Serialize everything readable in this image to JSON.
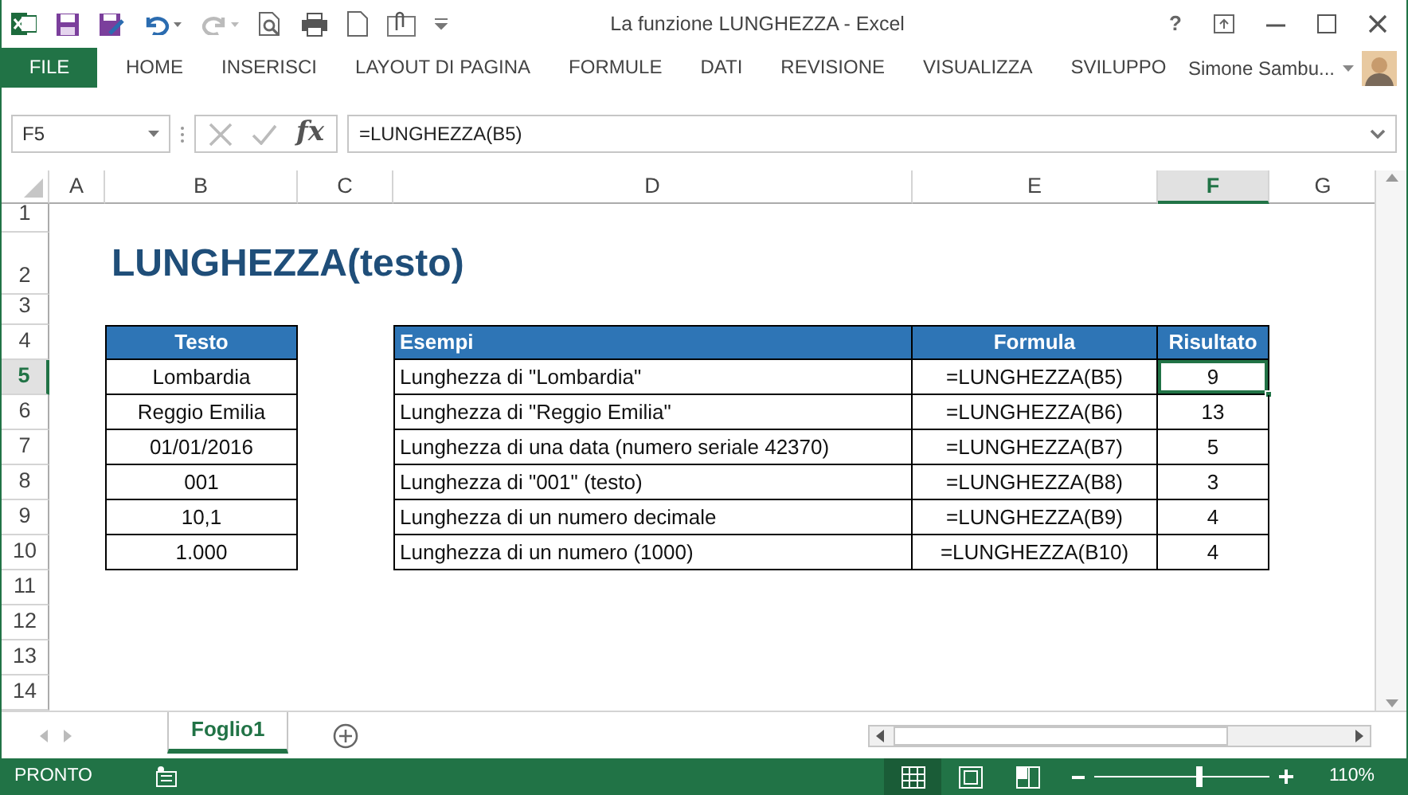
{
  "window": {
    "title": "La funzione LUNGHEZZA - Excel",
    "help": "?"
  },
  "ribbon": {
    "tabs": [
      {
        "label": "FILE",
        "kind": "file",
        "selected": false
      },
      {
        "label": "HOME",
        "kind": "tab",
        "selected": false
      },
      {
        "label": "INSERISCI",
        "kind": "tab",
        "selected": false
      },
      {
        "label": "LAYOUT DI PAGINA",
        "kind": "tab",
        "selected": false
      },
      {
        "label": "FORMULE",
        "kind": "tab",
        "selected": false
      },
      {
        "label": "DATI",
        "kind": "tab",
        "selected": false
      },
      {
        "label": "REVISIONE",
        "kind": "tab",
        "selected": false
      },
      {
        "label": "VISUALIZZA",
        "kind": "tab",
        "selected": false
      },
      {
        "label": "SVILUPPO",
        "kind": "tab",
        "selected": false
      }
    ],
    "user": "Simone Sambu..."
  },
  "formula_bar": {
    "name_box": "F5",
    "function_symbol": "fx",
    "formula": "=LUNGHEZZA(B5)"
  },
  "sheet": {
    "columns": [
      {
        "label": "A",
        "selected": false
      },
      {
        "label": "B",
        "selected": false
      },
      {
        "label": "C",
        "selected": false
      },
      {
        "label": "D",
        "selected": false
      },
      {
        "label": "E",
        "selected": false
      },
      {
        "label": "F",
        "selected": true
      },
      {
        "label": "G",
        "selected": false
      }
    ],
    "rows": [
      {
        "label": "1",
        "selected": false
      },
      {
        "label": "2",
        "selected": false
      },
      {
        "label": "3",
        "selected": false
      },
      {
        "label": "4",
        "selected": false
      },
      {
        "label": "5",
        "selected": true
      },
      {
        "label": "6",
        "selected": false
      },
      {
        "label": "7",
        "selected": false
      },
      {
        "label": "8",
        "selected": false
      },
      {
        "label": "9",
        "selected": false
      },
      {
        "label": "10",
        "selected": false
      },
      {
        "label": "11",
        "selected": false
      },
      {
        "label": "12",
        "selected": false
      },
      {
        "label": "13",
        "selected": false
      },
      {
        "label": "14",
        "selected": false
      }
    ],
    "title": "LUNGHEZZA(testo)",
    "text_table": {
      "header": "Testo",
      "values": [
        "Lombardia",
        "Reggio Emilia",
        "01/01/2016",
        "001",
        "10,1",
        "1.000"
      ]
    },
    "examples_table": {
      "columns": [
        "Esempi",
        "Formula",
        "Risultato"
      ],
      "rows": [
        {
          "description": "Lunghezza di \"Lombardia\"",
          "formula": "=LUNGHEZZA(B5)",
          "result": "9",
          "selected": true
        },
        {
          "description": "Lunghezza di \"Reggio Emilia\"",
          "formula": "=LUNGHEZZA(B6)",
          "result": "13",
          "selected": false
        },
        {
          "description": "Lunghezza di una data (numero seriale 42370)",
          "formula": "=LUNGHEZZA(B7)",
          "result": "5",
          "selected": false
        },
        {
          "description": "Lunghezza di \"001\" (testo)",
          "formula": "=LUNGHEZZA(B8)",
          "result": "3",
          "selected": false
        },
        {
          "description": "Lunghezza di un numero decimale",
          "formula": "=LUNGHEZZA(B9)",
          "result": "4",
          "selected": false
        },
        {
          "description": "Lunghezza di un numero (1000)",
          "formula": "=LUNGHEZZA(B10)",
          "result": "4",
          "selected": false
        }
      ]
    }
  },
  "sheet_tabs": [
    {
      "label": "Foglio1",
      "selected": true
    }
  ],
  "status_bar": {
    "status": "PRONTO",
    "views": [
      {
        "kind": "normal",
        "selected": true
      },
      {
        "kind": "page-layout",
        "selected": false
      },
      {
        "kind": "page-break",
        "selected": false
      }
    ],
    "zoom": {
      "level": 0.6,
      "reading": "110%"
    }
  }
}
